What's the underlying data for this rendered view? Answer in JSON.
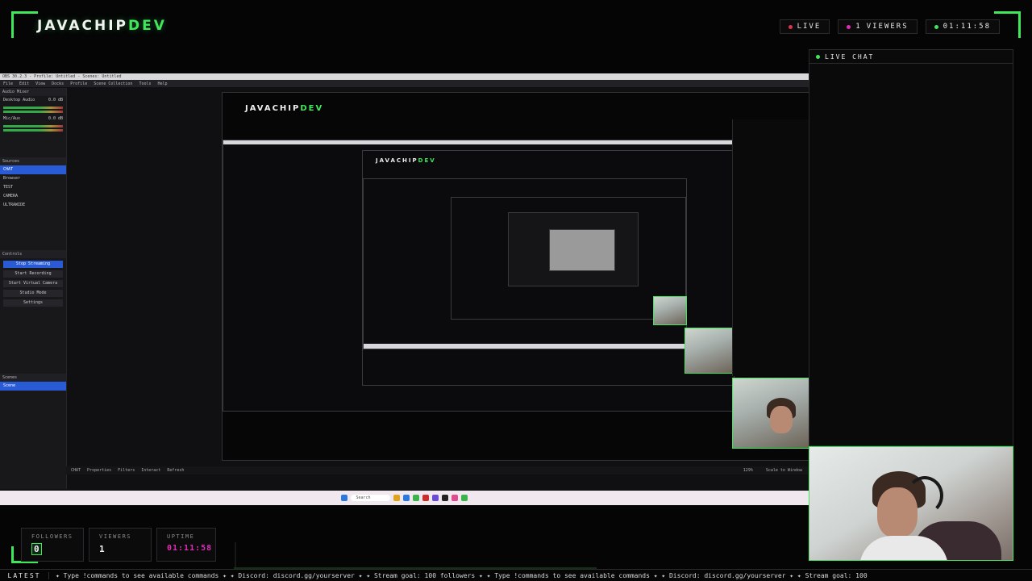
{
  "brand": {
    "left": "JAVACHIP",
    "right": "DEV"
  },
  "header": {
    "live_label": "LIVE",
    "viewers_count": "1",
    "viewers_label": "VIEWERS",
    "uptime": "01:11:58"
  },
  "chat": {
    "title": "LIVE CHAT"
  },
  "obs": {
    "title": "OBS 30.2.3 - Profile: Untitled - Scenes: Untitled",
    "menu": [
      "File",
      "Edit",
      "View",
      "Docks",
      "Profile",
      "Scene Collection",
      "Tools",
      "Help"
    ],
    "audio_header": "Audio Mixer",
    "audio_tracks": [
      {
        "name": "Desktop Audio",
        "level": "0.0 dB"
      },
      {
        "name": "Mic/Aux",
        "level": "0.0 dB"
      }
    ],
    "sources_header": "Sources",
    "sources": [
      "CHAT",
      "Browser",
      "TEST",
      "CAMERA",
      "ULTRAWIDE"
    ],
    "controls_header": "Controls",
    "controls": [
      "Stop Streaming",
      "Start Recording",
      "Start Virtual Camera",
      "Studio Mode",
      "Settings"
    ],
    "scenes_header": "Scenes",
    "scenes": [
      "Scene"
    ],
    "bottom_bar": [
      "CHAT",
      "Properties",
      "Filters",
      "Interact",
      "Refresh"
    ],
    "zoom": "129%",
    "scale_label": "Scale to Window"
  },
  "taskbar": {
    "search_placeholder": "Search"
  },
  "stats": {
    "followers_label": "FOLLOWERS",
    "followers_value": "0",
    "viewers_label": "VIEWERS",
    "viewers_value": "1",
    "uptime_label": "UPTIME",
    "uptime_value": "01:11:58"
  },
  "ticker": {
    "label": "LATEST",
    "text": "✦ Type !commands to see available commands ✦ ✦ Discord: discord.gg/yourserver ✦ ✦ Stream goal: 100 followers ✦ ✦ Type !commands to see available commands ✦ ✦ Discord: discord.gg/yourserver ✦ ✦ Stream goal: 100"
  },
  "colors": {
    "accent": "#3ee85a",
    "live": "#e0334a",
    "magenta": "#e02bb7",
    "background": "#050506"
  }
}
